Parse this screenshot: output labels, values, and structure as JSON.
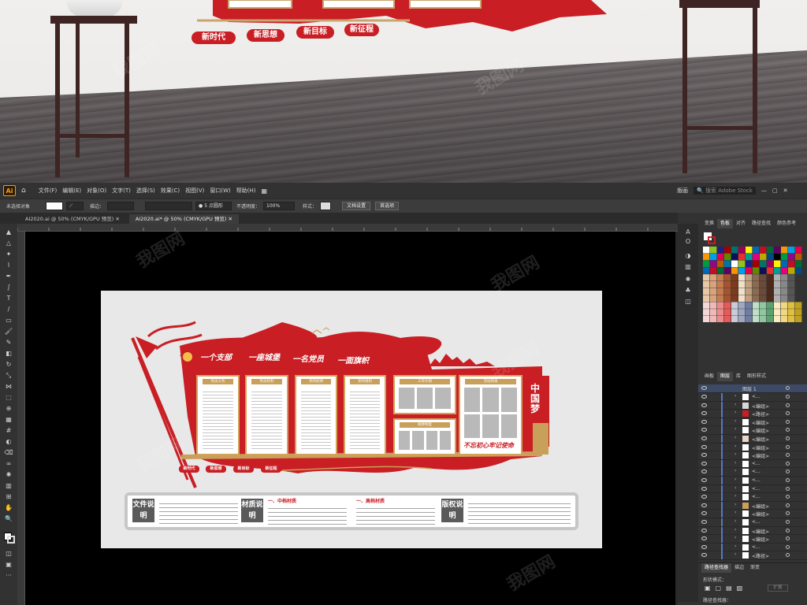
{
  "room": {
    "pills": [
      "新时代",
      "新思想",
      "新目标",
      "新征程"
    ]
  },
  "menubar": {
    "logo": "Ai",
    "items": [
      "文件(F)",
      "编辑(E)",
      "对象(O)",
      "文字(T)",
      "选择(S)",
      "效果(C)",
      "视图(V)",
      "窗口(W)",
      "帮助(H)"
    ],
    "workspace": "版画",
    "search_placeholder": "搜索 Adobe Stock"
  },
  "controlbar": {
    "selection": "未选择对象",
    "stroke_label": "描边：",
    "brush_value": "5 点圆形",
    "opacity_label": "不透明度：",
    "opacity_value": "100%",
    "style_label": "样式：",
    "doc_settings": "文档设置",
    "preferences": "首选项"
  },
  "tabs": [
    {
      "label": "AI2020.ai @ 50% (CMYK/GPU 预览)"
    },
    {
      "label": "AI2020.ai* @ 50% (CMYK/GPU 预览)"
    }
  ],
  "artwork": {
    "slogans": [
      "一个支部",
      "一座城堡",
      "一名党员",
      "一面旗帜"
    ],
    "panel_tags": [
      "党员义务",
      "党员权利",
      "党的纪律",
      "党的组织",
      "工作计划",
      "规章制度",
      "活动风采",
      "活动风采"
    ],
    "labels": [
      "新时代",
      "新思想",
      "新目标",
      "新征程"
    ],
    "china_dream": "中国梦",
    "banner": "不忘初心牢记使命",
    "desc_tags": [
      "文件说明",
      "材质说明",
      "版权说明"
    ],
    "material_titles": [
      "一、中档材质",
      "一、高档材质"
    ]
  },
  "right_panel": {
    "top_tabs": [
      "变换",
      "色板",
      "对齐",
      "路径查找",
      "颜色参考"
    ],
    "layer_tabs": [
      "画板",
      "图层",
      "库",
      "图形样式"
    ],
    "layer_main": "图层 1",
    "layer_items": [
      "<...",
      "<编组>",
      "<路径>",
      "<编组>",
      "<编组>",
      "<编组>",
      "<编组>",
      "<编组>",
      "<...",
      "<...",
      "<...",
      "<...",
      "<...",
      "<编组>",
      "<编组>",
      "<...",
      "<编组>",
      "<编组>",
      "<...",
      "<路径>"
    ],
    "bottom_tabs": [
      "路径查找器",
      "描边",
      "渐变"
    ],
    "shape_mode": "形状模式：",
    "pathfinder": "路径查找器：",
    "expand": "扩展"
  },
  "colors": {
    "brand_red": "#c81e24",
    "gold": "#c9a05a"
  }
}
